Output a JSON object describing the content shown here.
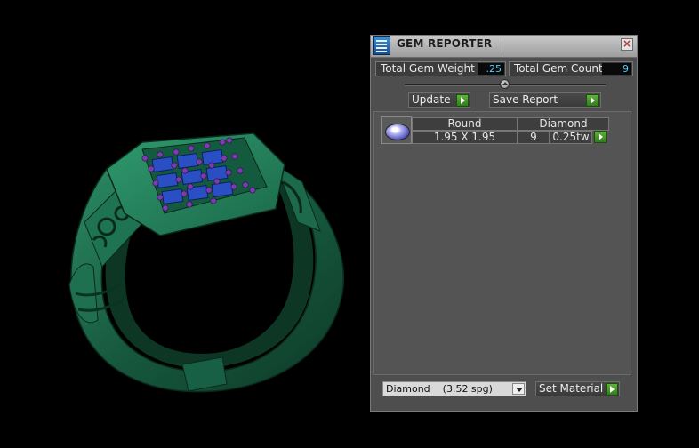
{
  "window": {
    "title": "GEM REPORTER",
    "icon": "gem-reporter-app-icon",
    "close_icon": "close-icon"
  },
  "stats": {
    "total_weight_label": "Total Gem Weight",
    "total_weight_value": ".25",
    "total_count_label": "Total Gem Count",
    "total_count_value": "9"
  },
  "toolbar": {
    "update_label": "Update",
    "save_report_label": "Save Report"
  },
  "gems": [
    {
      "shape": "Round",
      "size": "1.95 X 1.95",
      "material": "Diamond",
      "count": "9",
      "weight": "0.25tw"
    }
  ],
  "material_picker": {
    "selected": "Diamond    (3.52 spg)",
    "set_label": "Set Material"
  },
  "colors": {
    "value_text": "#4fd0ff",
    "ring_metal": "#1f6b4d",
    "gem_blue": "#2a4fc4",
    "prong_purple": "#7a3db0",
    "go_button": "#3f9426"
  }
}
